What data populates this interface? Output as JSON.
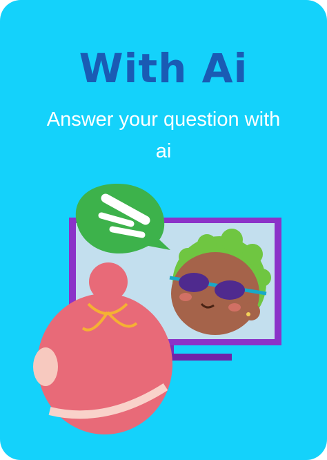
{
  "card": {
    "title": "With Ai",
    "subtitle": "Answer your question with ai",
    "background_color": "#14d2fb",
    "title_color": "#1a5bb4",
    "subtitle_color": "#ffffff"
  },
  "illustration": {
    "description_icons": [
      "chat-bubble-icon",
      "monitor-icon",
      "avatar-with-sunglasses",
      "person-back-view"
    ]
  }
}
